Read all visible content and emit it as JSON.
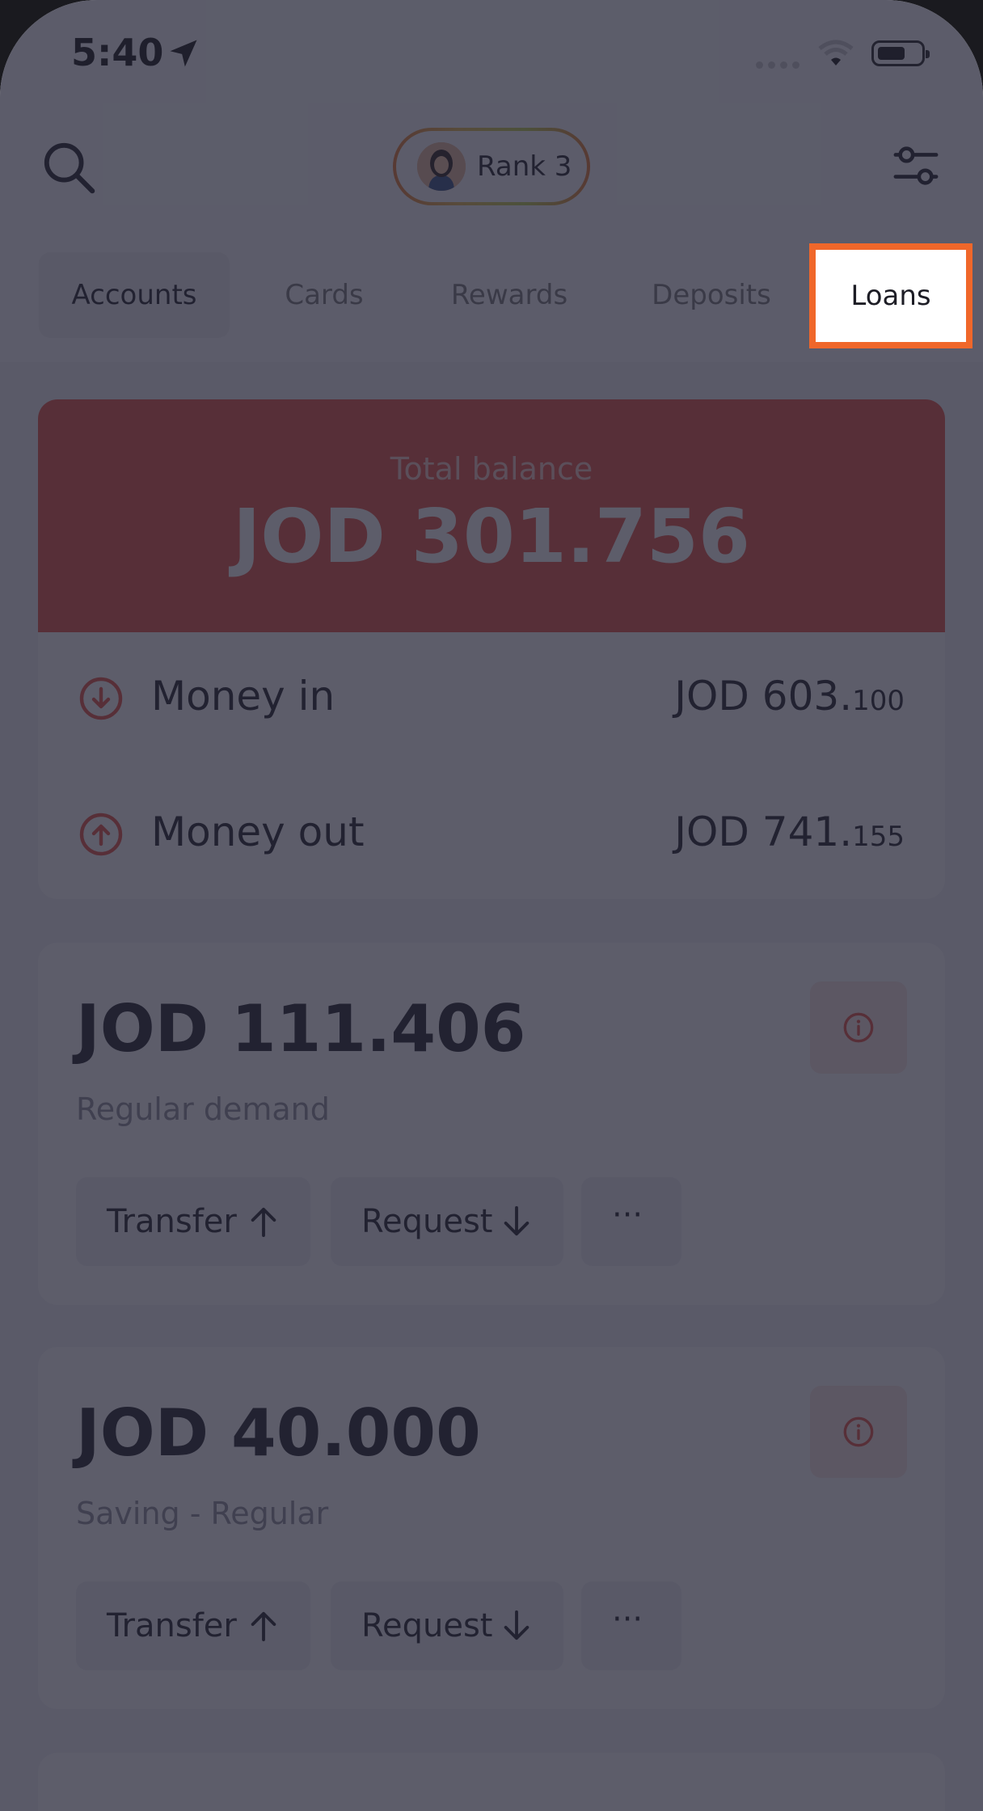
{
  "status_bar": {
    "time": "5:40"
  },
  "header": {
    "rank_label": "Rank 3"
  },
  "tabs": [
    {
      "label": "Accounts"
    },
    {
      "label": "Cards"
    },
    {
      "label": "Rewards"
    },
    {
      "label": "Deposits"
    },
    {
      "label": "Loans"
    }
  ],
  "summary": {
    "total_label": "Total balance",
    "total_value": "JOD 301.756",
    "money_in_label": "Money in",
    "money_in_main": "JOD 603.",
    "money_in_decimals": "100",
    "money_out_label": "Money out",
    "money_out_main": "JOD 741.",
    "money_out_decimals": "155"
  },
  "accounts": [
    {
      "balance": "JOD 111.406",
      "type": "Regular demand",
      "transfer_label": "Transfer",
      "request_label": "Request",
      "more_label": "···"
    },
    {
      "balance": "JOD 40.000",
      "type": "Saving - Regular",
      "transfer_label": "Transfer",
      "request_label": "Request",
      "more_label": "···"
    }
  ],
  "colors": {
    "accent": "#e84e3f",
    "highlight": "#f0672a",
    "overlay": "#242536"
  },
  "icons": [
    "location-arrow-icon",
    "signal-icon",
    "wifi-icon",
    "battery-icon",
    "search-icon",
    "filter-icon",
    "arrow-down-circle-icon",
    "arrow-up-circle-icon",
    "info-icon",
    "arrow-up-icon",
    "arrow-down-icon",
    "more-icon"
  ]
}
